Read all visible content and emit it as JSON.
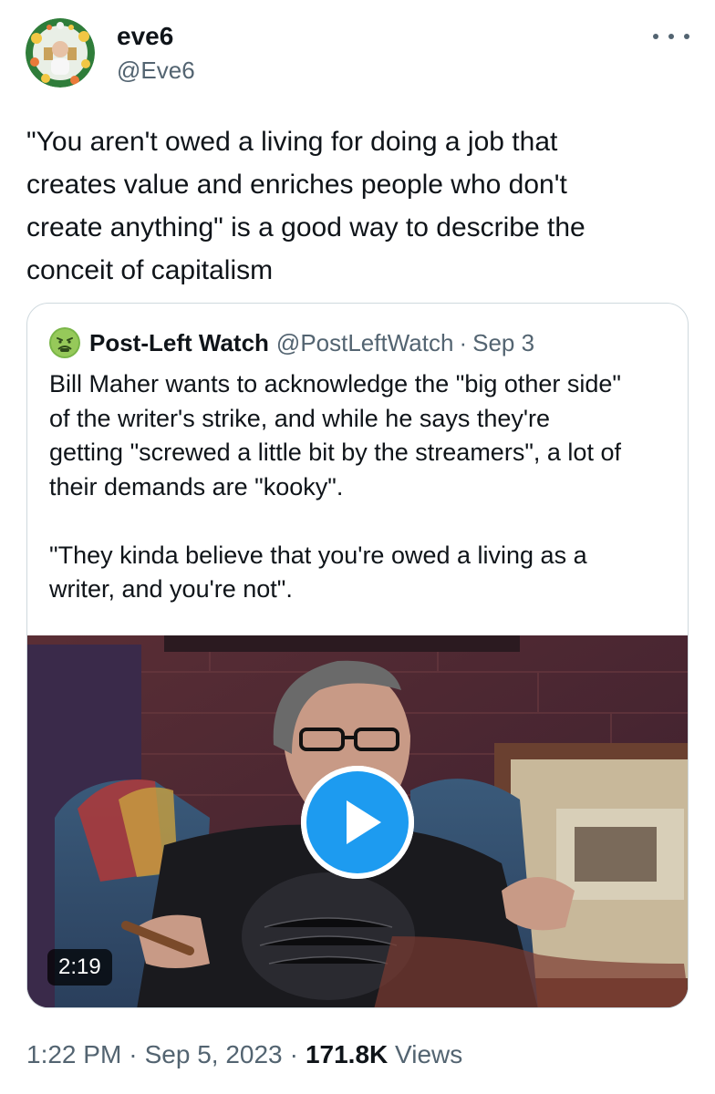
{
  "author": {
    "display_name": "eve6",
    "handle": "@Eve6"
  },
  "tweet": {
    "text": "\"You aren't owed a living for doing a job that\ncreates value and enriches people who don't\ncreate anything\" is a good way to describe the\nconceit of capitalism"
  },
  "quoted_tweet": {
    "display_name": "Post-Left Watch",
    "handle": "@PostLeftWatch",
    "separator": "·",
    "date": "Sep 3",
    "text": "Bill Maher wants to acknowledge the \"big other side\"\nof the writer's strike, and while he says they're\ngetting \"screwed a little bit by the streamers\", a lot of\ntheir demands are \"kooky\".\n\n\"They kinda believe that you're owed a living as a\nwriter, and you're not\".",
    "video": {
      "duration": "2:19"
    }
  },
  "meta": {
    "time": "1:22 PM",
    "separator": "·",
    "date": "Sep 5, 2023",
    "views_count": "171.8K",
    "views_label": "Views"
  },
  "colors": {
    "text_primary": "#0f1419",
    "text_secondary": "#536471",
    "border": "#cfd9de",
    "play_blue": "#1d9bf0"
  },
  "icons": {
    "avatar": "avatar-image",
    "quoted_avatar": "sick-face-icon",
    "more": "more-options-icon",
    "play": "play-icon"
  }
}
